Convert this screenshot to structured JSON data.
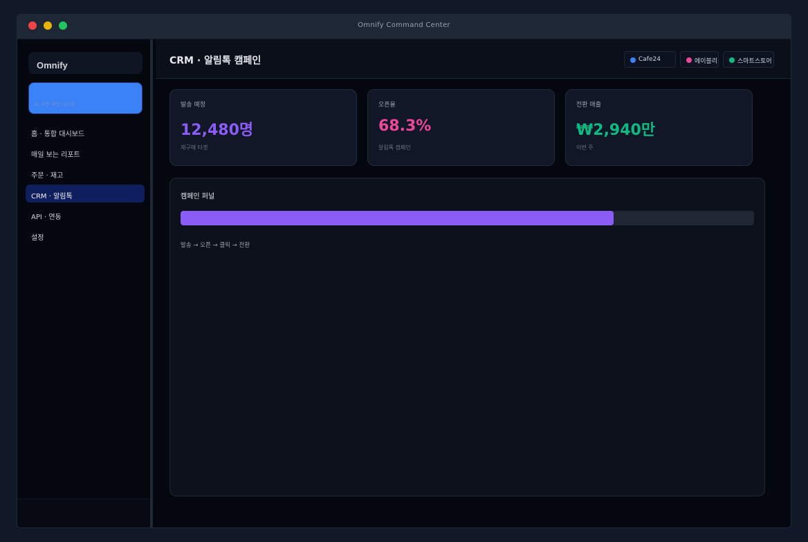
{
  "window": {
    "title": "Omnify Command Center"
  },
  "sidebar": {
    "brand": "Omnify",
    "highlight_card_text": "AI 추천 액션 대기중",
    "items": [
      {
        "label": "홈 · 통합 대시보드",
        "active": false
      },
      {
        "label": "매일 보는 리포트",
        "active": false
      },
      {
        "label": "주문 · 재고",
        "active": false
      },
      {
        "label": "CRM · 알림톡",
        "active": true
      },
      {
        "label": "API · 연동",
        "active": false
      },
      {
        "label": "설정",
        "active": false
      }
    ]
  },
  "header": {
    "title": "CRM · 알림톡 캠페인",
    "channels": [
      {
        "label": "Cafe24",
        "color": "#3b82f6"
      },
      {
        "label": "에이블리",
        "color": "#ec4899"
      },
      {
        "label": "스마트스토어",
        "color": "#10b981"
      }
    ]
  },
  "kpis": [
    {
      "label": "발송 예정",
      "value": "12,480명",
      "sub": "재구매 타겟",
      "color": "#8b5cf6"
    },
    {
      "label": "오픈율",
      "value": "68.3%",
      "sub": "알림톡 캠페인",
      "color": "#ec4899"
    },
    {
      "label": "전환 매출",
      "value": "₩2,940만",
      "sub": "이번 주",
      "color": "#10b981"
    }
  ],
  "funnel": {
    "title": "캠페인 퍼널",
    "progress": 0.755,
    "caption": "발송 → 오픈 → 클릭 → 전환"
  }
}
